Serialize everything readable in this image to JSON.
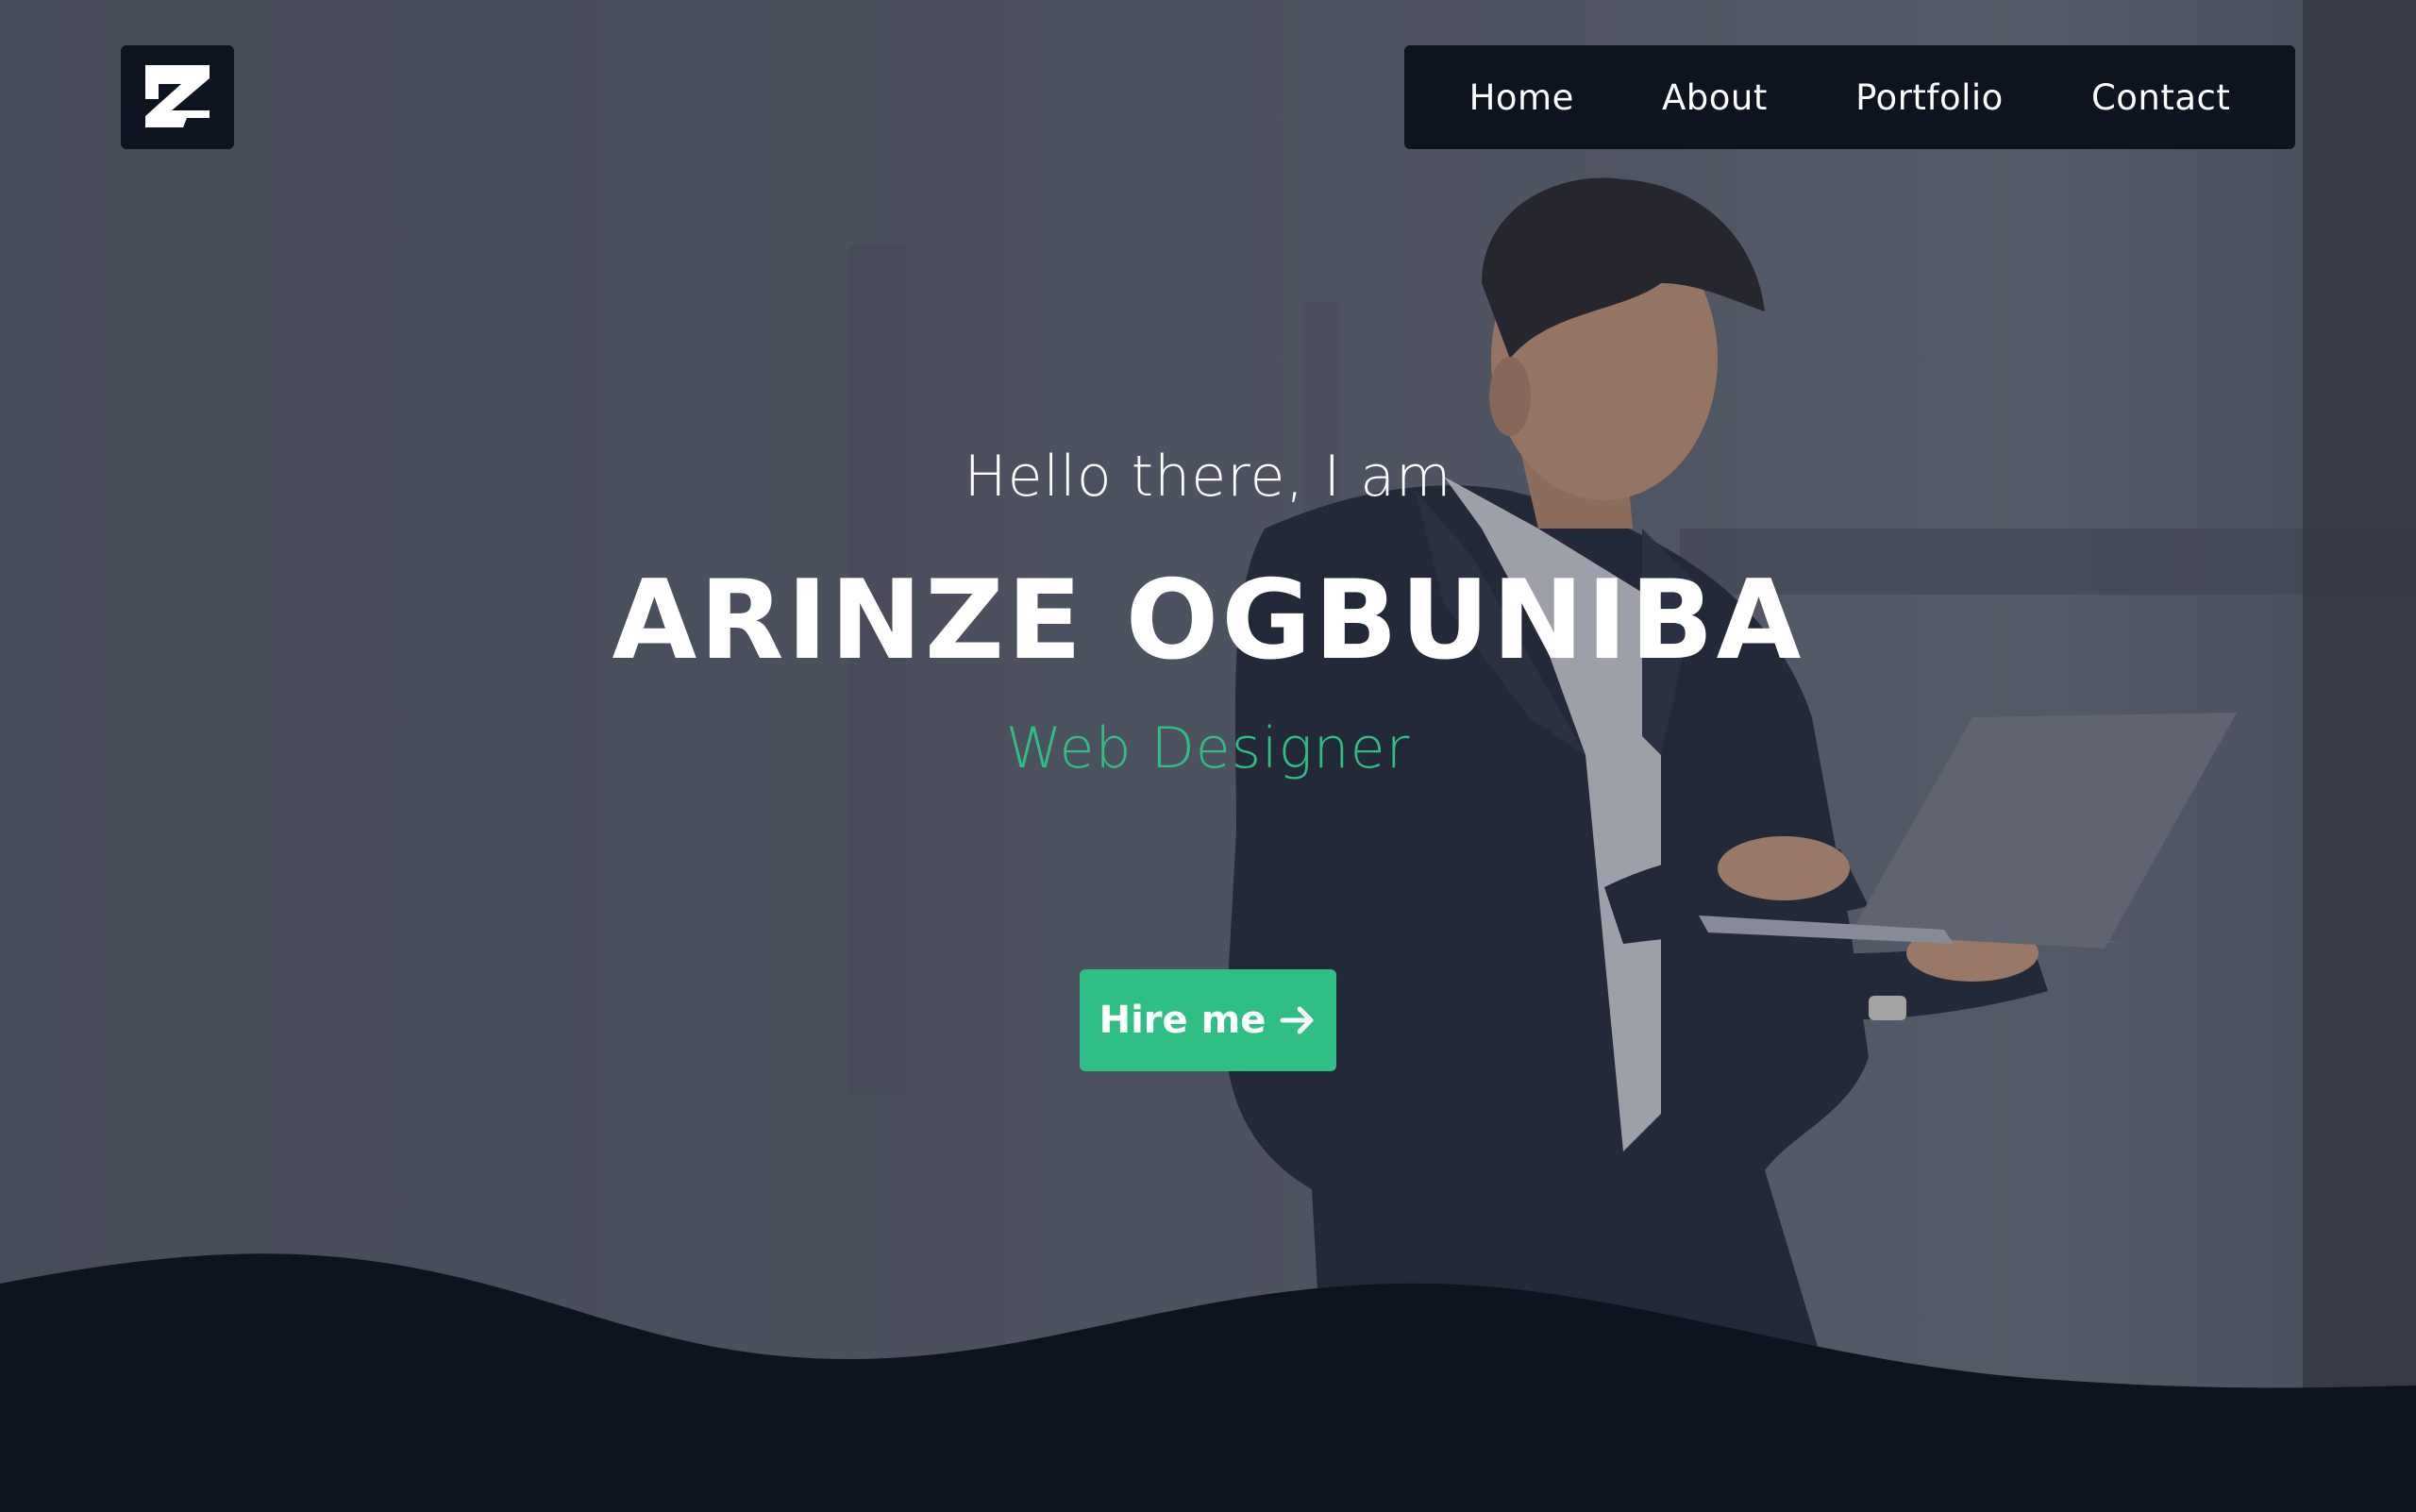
{
  "brand": {
    "logo_letter": "Z",
    "logo_icon": "brand-logo-icon"
  },
  "nav": {
    "items": [
      {
        "label": "Home"
      },
      {
        "label": "About"
      },
      {
        "label": "Portfolio"
      },
      {
        "label": "Contact"
      }
    ]
  },
  "hero": {
    "greeting": "Hello there, I am",
    "name": "ARINZE OGBUNIBA",
    "role": "Web Designer",
    "cta_label": "Hire me",
    "cta_icon": "arrow-right-icon"
  },
  "colors": {
    "accent": "#2fbf85",
    "dark": "#0d141f",
    "overlay": "#4f5461"
  }
}
